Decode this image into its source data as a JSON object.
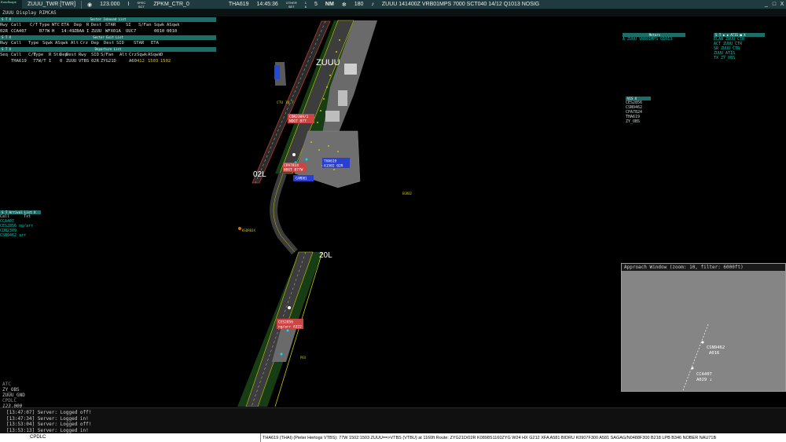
{
  "topbar": {
    "logo_text": "EuroScope",
    "callsign_text": "ZUUU_TWR [TWR]",
    "frequency": "123.000",
    "freq_marker": "I",
    "atc_label_top": "SPEC",
    "atc_label_bottom": "SCT",
    "atc_name": "ZPKM_CTR_0",
    "aircraft": "THA619",
    "time": "14:45:36",
    "other_top": "OTHER",
    "other_mid": "SET",
    "other_bot": "SET",
    "ratio_top": "1",
    "ratio_bot": "6",
    "range_value": "5",
    "range_unit": "NM",
    "heading_value": "180",
    "metar": "ZUUU 141400Z VRB01MPS 7000 SCT040 14/12 Q1013 NOSIG",
    "minimize": "_",
    "maximize": "□",
    "close": "X"
  },
  "subbar": {
    "text": "ZUUU Display RIMCAS"
  },
  "sector_inbound": {
    "title": "Sector Inbound List",
    "headers": [
      "Rwy",
      "Call",
      "C/T",
      "Type",
      "WTC",
      "ETA",
      "Dep",
      "R",
      "Dest",
      "STAR",
      "SI",
      "S/Fan",
      "Sqwk",
      "ASqwk"
    ],
    "row": [
      "02R",
      "CCA407",
      "",
      "B77W",
      "H",
      "14:49",
      "ZBAA",
      "I",
      "ZUUU",
      "WFX01A",
      "UUC7",
      "",
      "0010",
      "0010"
    ]
  },
  "sector_exit": {
    "title": "Sector Exit List",
    "headers": [
      "Rwy",
      "Call",
      "Type",
      "Sqwk",
      "ASqwk",
      "Alt",
      "Crz",
      "Dep",
      "Dest",
      "SID",
      "STAR",
      "ETA"
    ]
  },
  "departure_list": {
    "title": "Departure List",
    "headers": [
      "Seq",
      "Call",
      "C/T",
      "Type",
      "R",
      "Sts",
      "Dep",
      "Dest",
      "Rwy",
      "SID",
      "S/Fan",
      "Alt",
      "Crz",
      "Sqwk",
      "ASqwk",
      "D"
    ],
    "row": [
      "",
      "THA619",
      "",
      "77W/T",
      "I",
      "",
      "0",
      "ZUUU",
      "VTBS",
      "02R",
      "ZYG21D",
      "",
      "A60",
      "412",
      "1503",
      "1502"
    ]
  },
  "arrival_list": {
    "title": "Arrival List",
    "headers": [
      "Call",
      "Txt"
    ],
    "rows": [
      {
        "call": "CCA407",
        "txt": ""
      },
      {
        "call": "CES2856",
        "txt": "ng/arr"
      },
      {
        "call": "CDN2309",
        "txt": ""
      },
      {
        "call": "CSN9462",
        "txt": "arr"
      }
    ]
  },
  "metars_panel": {
    "title": "Metars",
    "line": "A ZUUU VRB01MPS Q1013"
  },
  "atis_panel": {
    "title": "ATIS",
    "lines": [
      "ELAN ZUUU_CTR",
      "ACT ZUUU_CTR",
      "SR ZUUU_CTR",
      "ZUUU_ATIS",
      "TX ZY_OBS"
    ]
  },
  "vis_panel": {
    "title": "VIS",
    "lines": [
      "CES2856",
      "CSN9462",
      "CPA7824",
      "THA619",
      "ZY_OBS"
    ]
  },
  "map": {
    "airport_label": "ZUUU",
    "rwy_02l": "02L",
    "rwy_20l": "20L",
    "ctu_label": "CTU 10.7",
    "fix_label": "EGR02",
    "fix_label2": "KSDR03X",
    "tags": [
      {
        "l1": "CDN2309/1",
        "l2": "NOGT B77",
        "color": "#c44"
      },
      {
        "l1": "CPA7824",
        "l2": "NOGT B77W",
        "color": "#c44"
      },
      {
        "l1": "THA619",
        "l2": "A1502 02R",
        "color": "#2a3fd0"
      },
      {
        "l1": "CES2856",
        "l2": "ng/arr A322",
        "color": "#c44"
      },
      {
        "l1": "CAMD01",
        "l2": "",
        "color": "#2a3fd0"
      }
    ],
    "small_label": "PEX"
  },
  "approach_window": {
    "title": "Approach Window (zoom: 10, filter: 6000ft)",
    "ac1_call": "CSN9462",
    "ac1_alt": "A016",
    "ac2_call": "CCA407",
    "ac2_alt": "A029 ↓"
  },
  "atc_block": {
    "l1": "ATC",
    "l2": "ZY_OBS",
    "l3": "ZUUU_GND",
    "l4": "CPDLC",
    "l5": "123.000"
  },
  "console": {
    "lines": [
      "[13:47:07] Server: Logged off!",
      "[13:47:34] Server: Logged in!",
      "[13:53:04] Server: Logged off!",
      "[13:53:13] Server: Logged in!"
    ]
  },
  "status": {
    "command": "CPDLC",
    "flightplan": "THA619 (THAI) (Pieter Hertogs VTBS): 77W 1502:1503 ZUUU==>VTBS (VTBU) at 1160ft Route: ZYG21D/02R K0898S1160ZYG W24 HX G212 XFA A581 BIDRU K0907F300 A581 SAGAG/N0488F300 B218 LPB B346 NOBER NAU71B"
  },
  "colors": {
    "toolbar": "#1f3b3f",
    "panel_title": "#1d6e68",
    "teal_text": "#00c8b4",
    "runway_edge": "#c8c800",
    "grass": "#173d14",
    "apron": "#6a6a6a",
    "tag_red": "#c44",
    "tag_blue": "#2a3fd0"
  }
}
